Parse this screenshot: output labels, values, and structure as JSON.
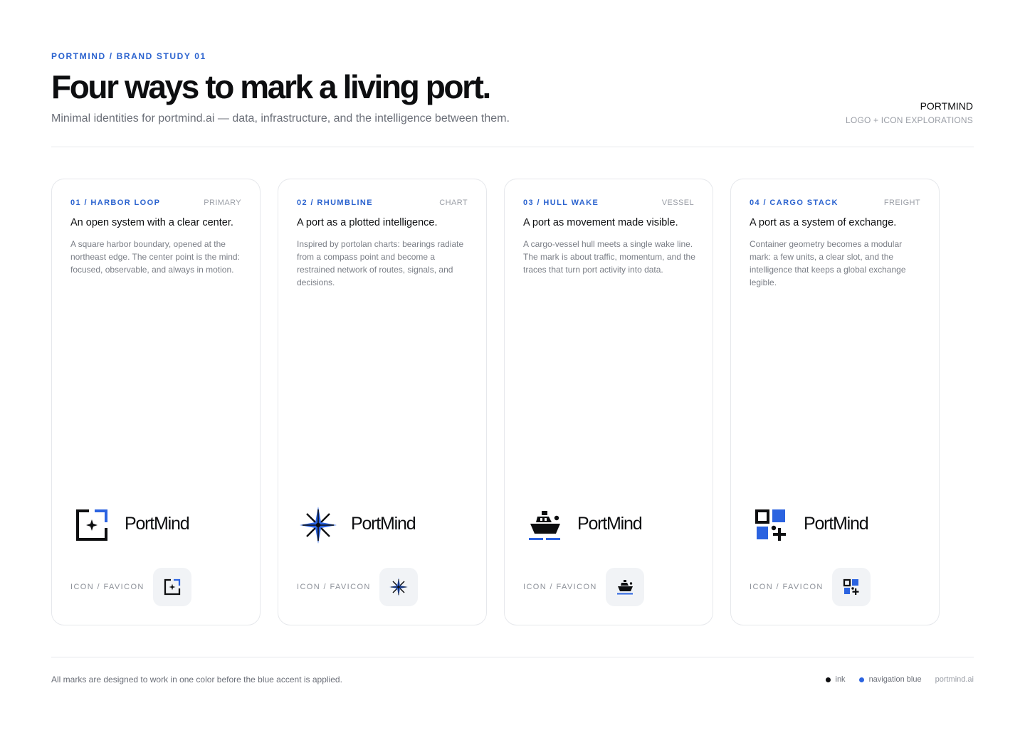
{
  "header": {
    "eyebrow": "PORTMIND / BRAND STUDY 01",
    "title": "Four ways to mark a living port.",
    "subtitle": "Minimal identities for portmind.ai — data, infrastructure, and the intelligence between them.",
    "brand_name": "PORTMIND",
    "brand_sub": "LOGO + ICON EXPLORATIONS"
  },
  "cards": [
    {
      "label": "01 / HARBOR LOOP",
      "tag": "PRIMARY",
      "headline": "An open system with a clear center.",
      "body": "A square harbor boundary, opened at the northeast edge. The center point is the mind: focused, observable, and always in motion.",
      "wordmark": "PortMind",
      "fav_label": "ICON / FAVICON",
      "icon": "harbor-loop-icon"
    },
    {
      "label": "02 / RHUMBLINE",
      "tag": "CHART",
      "headline": "A port as a plotted intelligence.",
      "body": "Inspired by portolan charts: bearings radiate from a compass point and become a restrained network of routes, signals, and decisions.",
      "wordmark": "PortMind",
      "fav_label": "ICON / FAVICON",
      "icon": "compass-star-icon"
    },
    {
      "label": "03 / HULL WAKE",
      "tag": "VESSEL",
      "headline": "A port as movement made visible.",
      "body": "A cargo-vessel hull meets a single wake line. The mark is about traffic, momentum, and the traces that turn port activity into data.",
      "wordmark": "PortMind",
      "fav_label": "ICON / FAVICON",
      "icon": "ship-wake-icon"
    },
    {
      "label": "04 / CARGO STACK",
      "tag": "FREIGHT",
      "headline": "A port as a system of exchange.",
      "body": "Container geometry becomes a modular mark: a few units, a clear slot, and the intelligence that keeps a global exchange legible.",
      "wordmark": "PortMind",
      "fav_label": "ICON / FAVICON",
      "icon": "cargo-stack-icon"
    }
  ],
  "footer": {
    "note": "All marks are designed to work in one color before the blue accent is applied.",
    "legend_ink": "ink",
    "legend_blue": "navigation blue",
    "site": "portmind.ai"
  },
  "colors": {
    "ink": "#0d0e10",
    "navigation_blue": "#2b63e0"
  }
}
